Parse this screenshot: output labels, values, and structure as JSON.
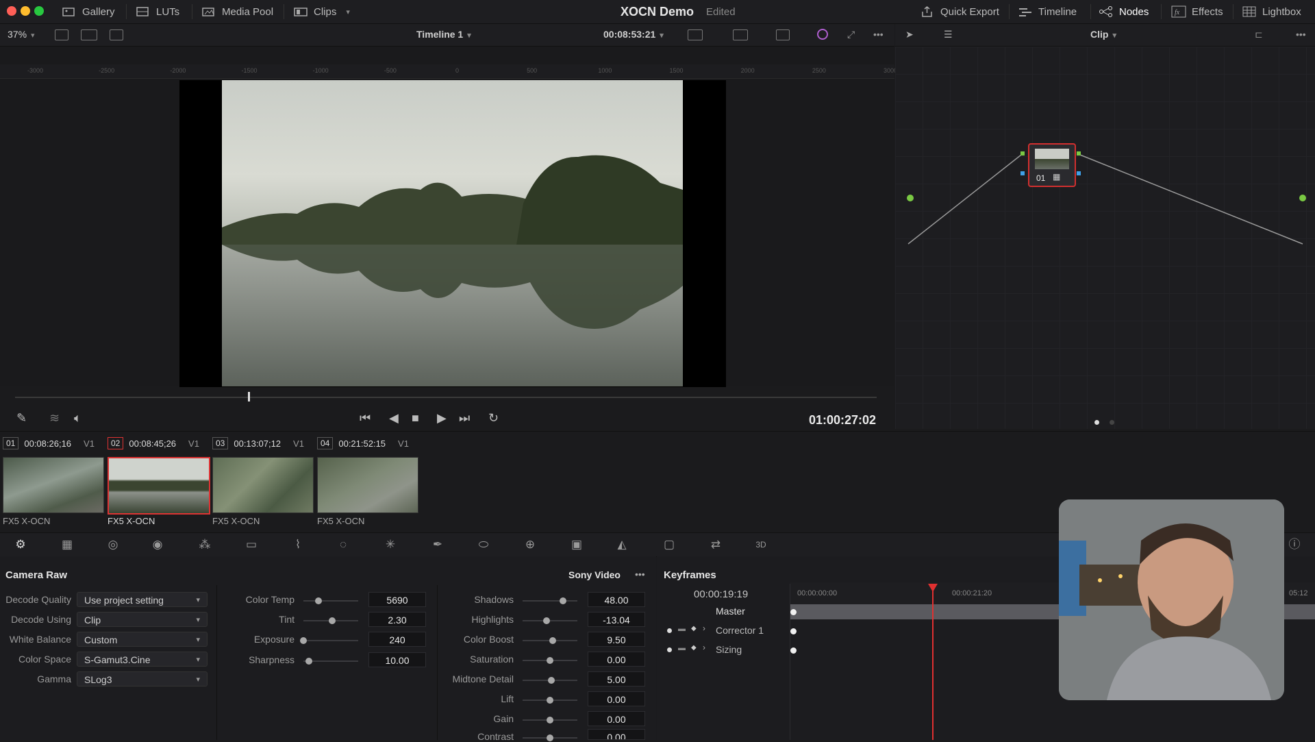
{
  "window": {
    "title": "XOCN Demo",
    "status": "Edited",
    "traffic_lights": {
      "close": "#ff5f57",
      "minimize": "#febc2e",
      "zoom": "#28c840"
    }
  },
  "top_nav": {
    "left": [
      {
        "label": "Gallery",
        "icon": "gallery-icon"
      },
      {
        "label": "LUTs",
        "icon": "luts-icon"
      },
      {
        "label": "Media Pool",
        "icon": "media-pool-icon"
      },
      {
        "label": "Clips",
        "icon": "clips-icon"
      }
    ],
    "right": [
      {
        "label": "Quick Export",
        "icon": "export-icon"
      },
      {
        "label": "Timeline",
        "icon": "timeline-icon"
      },
      {
        "label": "Nodes",
        "icon": "nodes-icon"
      },
      {
        "label": "Effects",
        "icon": "fx-icon"
      },
      {
        "label": "Lightbox",
        "icon": "lightbox-icon"
      }
    ]
  },
  "viewer_toolbar": {
    "zoom": "37%",
    "timeline_name": "Timeline 1",
    "timecode": "00:08:53:21",
    "node_mode": "Clip"
  },
  "viewer": {
    "ruler_ticks": [
      "-3000",
      "-2500",
      "-2000",
      "-1500",
      "-1000",
      "-500",
      "0",
      "500",
      "1000",
      "1500",
      "2000",
      "2500",
      "3000"
    ],
    "scrub_position_fraction": 0.27,
    "record_timecode": "01:00:27:02"
  },
  "node_editor": {
    "node_label": "01"
  },
  "clips": [
    {
      "num": "01",
      "timecode": "00:08:26;16",
      "track": "V1",
      "name": "FX5 X-OCN",
      "selected": false
    },
    {
      "num": "02",
      "timecode": "00:08:45;26",
      "track": "V1",
      "name": "FX5 X-OCN",
      "selected": true
    },
    {
      "num": "03",
      "timecode": "00:13:07;12",
      "track": "V1",
      "name": "FX5 X-OCN",
      "selected": false
    },
    {
      "num": "04",
      "timecode": "00:21:52:15",
      "track": "V1",
      "name": "FX5 X-OCN",
      "selected": false
    }
  ],
  "camera_raw": {
    "title": "Camera Raw",
    "preset": "Sony Video",
    "dropdowns": [
      {
        "label": "Decode Quality",
        "value": "Use project setting"
      },
      {
        "label": "Decode Using",
        "value": "Clip"
      },
      {
        "label": "White Balance",
        "value": "Custom"
      },
      {
        "label": "Color Space",
        "value": "S-Gamut3.Cine"
      },
      {
        "label": "Gamma",
        "value": "SLog3"
      }
    ],
    "sliders_left": [
      {
        "label": "Color Temp",
        "value": "5690",
        "level": 0.28
      },
      {
        "label": "Tint",
        "value": "2.30",
        "level": 0.52
      },
      {
        "label": "Exposure",
        "value": "240",
        "level": 0.0
      },
      {
        "label": "Sharpness",
        "value": "10.00",
        "level": 0.1
      }
    ],
    "sliders_right": [
      {
        "label": "Shadows",
        "value": "48.00",
        "level": 0.74
      },
      {
        "label": "Highlights",
        "value": "-13.04",
        "level": 0.44
      },
      {
        "label": "Color Boost",
        "value": "9.50",
        "level": 0.55
      },
      {
        "label": "Saturation",
        "value": "0.00",
        "level": 0.5
      },
      {
        "label": "Midtone Detail",
        "value": "5.00",
        "level": 0.53
      },
      {
        "label": "Lift",
        "value": "0.00",
        "level": 0.5
      },
      {
        "label": "Gain",
        "value": "0.00",
        "level": 0.5
      },
      {
        "label": "Contrast",
        "value": "0.00",
        "level": 0.5
      }
    ]
  },
  "keyframes": {
    "title": "Keyframes",
    "current_tc": "00:00:19:19",
    "ruler": [
      "00:00:00:00",
      "00:00:21:20",
      "05:12"
    ],
    "rows": [
      "Master",
      "Corrector 1",
      "Sizing"
    ]
  }
}
